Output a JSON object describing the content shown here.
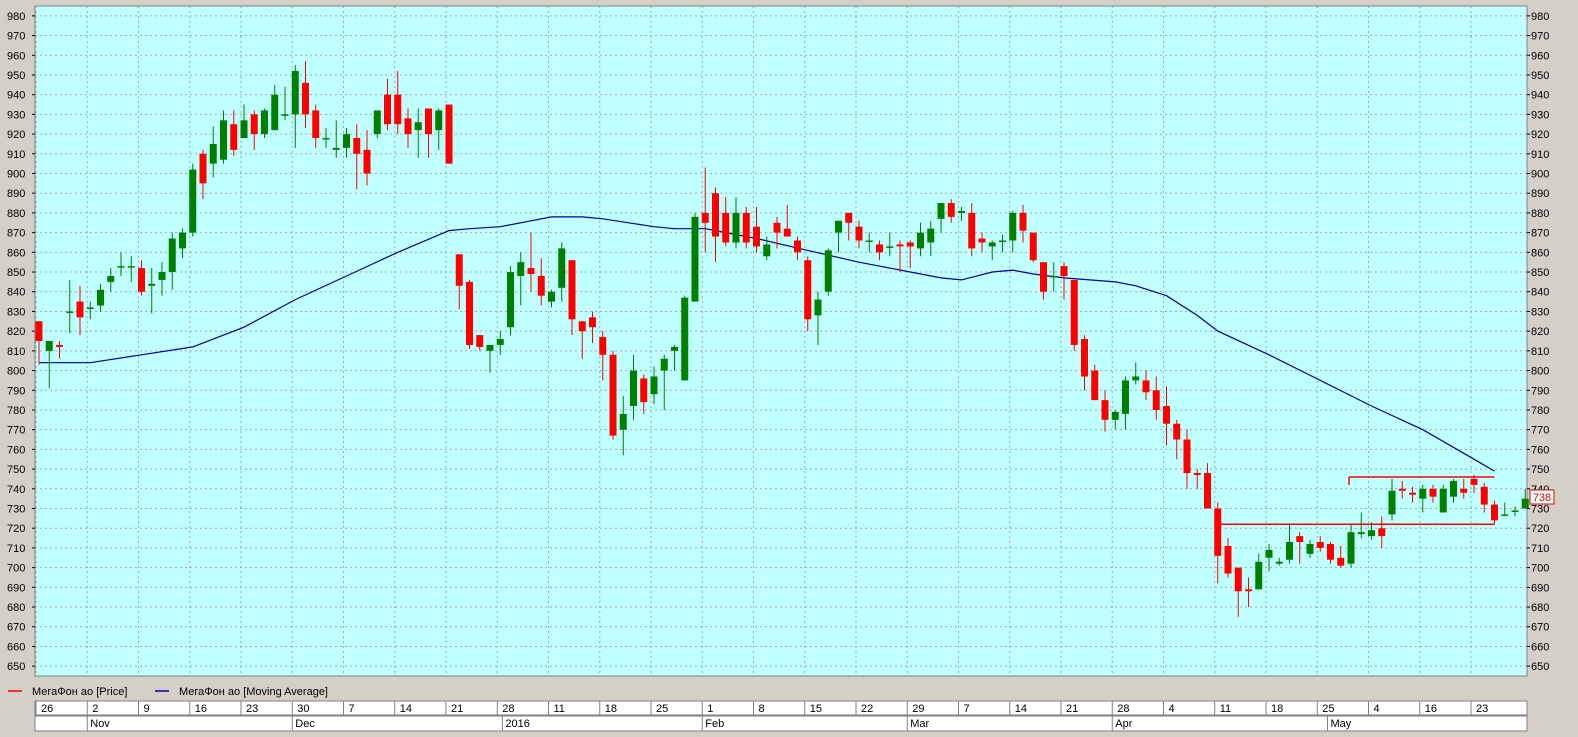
{
  "colors": {
    "background": "#c0ffff",
    "grid": "#a8a8a8",
    "up": "#008000",
    "down": "#ff0000",
    "ma": "#0000a0",
    "level": "#ff0000",
    "frame": "#d4d0c8"
  },
  "legend": [
    {
      "label": "МегаФон ао [Price]",
      "color": "#ff0000"
    },
    {
      "label": "МегаФон ао [Moving Average]",
      "color": "#0000a0"
    }
  ],
  "last_price_label": "738",
  "chart_data": {
    "type": "candlestick",
    "ylim": [
      645,
      985
    ],
    "y_ticks": [
      650,
      660,
      670,
      680,
      690,
      700,
      710,
      720,
      730,
      740,
      750,
      760,
      770,
      780,
      790,
      800,
      810,
      820,
      830,
      840,
      850,
      860,
      870,
      880,
      890,
      900,
      910,
      920,
      930,
      940,
      950,
      960,
      970,
      980
    ],
    "x_day_labels": [
      {
        "i": 0,
        "label": "26"
      },
      {
        "i": 5,
        "label": "2"
      },
      {
        "i": 10,
        "label": "9"
      },
      {
        "i": 15,
        "label": "16"
      },
      {
        "i": 20,
        "label": "23"
      },
      {
        "i": 25,
        "label": "30"
      },
      {
        "i": 30,
        "label": "7"
      },
      {
        "i": 35,
        "label": "14"
      },
      {
        "i": 40,
        "label": "21"
      },
      {
        "i": 45,
        "label": "28"
      },
      {
        "i": 50,
        "label": "11"
      },
      {
        "i": 55,
        "label": "18"
      },
      {
        "i": 60,
        "label": "25"
      },
      {
        "i": 65,
        "label": "1"
      },
      {
        "i": 70,
        "label": "8"
      },
      {
        "i": 75,
        "label": "15"
      },
      {
        "i": 80,
        "label": "22"
      },
      {
        "i": 85,
        "label": "29"
      },
      {
        "i": 90,
        "label": "7"
      },
      {
        "i": 95,
        "label": "14"
      },
      {
        "i": 100,
        "label": "21"
      },
      {
        "i": 105,
        "label": "28"
      },
      {
        "i": 110,
        "label": "4"
      },
      {
        "i": 115,
        "label": "11"
      },
      {
        "i": 120,
        "label": "18"
      },
      {
        "i": 125,
        "label": "25"
      },
      {
        "i": 130,
        "label": "4"
      },
      {
        "i": 135,
        "label": "16"
      },
      {
        "i": 140,
        "label": "23"
      }
    ],
    "x_month_labels": [
      {
        "i": 5,
        "label": "Nov"
      },
      {
        "i": 25,
        "label": "Dec"
      },
      {
        "i": 45.5,
        "label": "2016"
      },
      {
        "i": 65,
        "label": "Feb"
      },
      {
        "i": 85,
        "label": "Mar"
      },
      {
        "i": 105,
        "label": "Apr"
      },
      {
        "i": 126,
        "label": "May"
      }
    ],
    "candles": [
      {
        "o": 825,
        "h": 825,
        "l": 803,
        "c": 815
      },
      {
        "o": 810,
        "h": 815,
        "l": 791,
        "c": 815
      },
      {
        "o": 813,
        "h": 815,
        "l": 806,
        "c": 812
      },
      {
        "o": 830,
        "h": 846,
        "l": 819,
        "c": 830
      },
      {
        "o": 835,
        "h": 843,
        "l": 818,
        "c": 827
      },
      {
        "o": 832,
        "h": 835,
        "l": 826,
        "c": 832
      },
      {
        "o": 833,
        "h": 844,
        "l": 830,
        "c": 841
      },
      {
        "o": 845,
        "h": 852,
        "l": 840,
        "c": 848
      },
      {
        "o": 853,
        "h": 860,
        "l": 848,
        "c": 853
      },
      {
        "o": 853,
        "h": 858,
        "l": 845,
        "c": 853
      },
      {
        "o": 852,
        "h": 856,
        "l": 838,
        "c": 840
      },
      {
        "o": 843,
        "h": 852,
        "l": 829,
        "c": 844
      },
      {
        "o": 846,
        "h": 855,
        "l": 838,
        "c": 850
      },
      {
        "o": 850,
        "h": 870,
        "l": 841,
        "c": 867
      },
      {
        "o": 862,
        "h": 872,
        "l": 857,
        "c": 870
      },
      {
        "o": 870,
        "h": 905,
        "l": 868,
        "c": 902
      },
      {
        "o": 910,
        "h": 912,
        "l": 887,
        "c": 895
      },
      {
        "o": 905,
        "h": 924,
        "l": 898,
        "c": 915
      },
      {
        "o": 907,
        "h": 932,
        "l": 905,
        "c": 927
      },
      {
        "o": 925,
        "h": 932,
        "l": 909,
        "c": 912
      },
      {
        "o": 918,
        "h": 935,
        "l": 918,
        "c": 927
      },
      {
        "o": 930,
        "h": 932,
        "l": 912,
        "c": 920
      },
      {
        "o": 920,
        "h": 933,
        "l": 918,
        "c": 932
      },
      {
        "o": 922,
        "h": 945,
        "l": 922,
        "c": 940
      },
      {
        "o": 930,
        "h": 944,
        "l": 927,
        "c": 930
      },
      {
        "o": 930,
        "h": 955,
        "l": 913,
        "c": 952
      },
      {
        "o": 946,
        "h": 957,
        "l": 923,
        "c": 930
      },
      {
        "o": 932,
        "h": 935,
        "l": 913,
        "c": 918
      },
      {
        "o": 918,
        "h": 923,
        "l": 913,
        "c": 918
      },
      {
        "o": 912,
        "h": 927,
        "l": 908,
        "c": 913
      },
      {
        "o": 913,
        "h": 923,
        "l": 908,
        "c": 920
      },
      {
        "o": 918,
        "h": 925,
        "l": 892,
        "c": 910
      },
      {
        "o": 912,
        "h": 922,
        "l": 894,
        "c": 900
      },
      {
        "o": 920,
        "h": 932,
        "l": 918,
        "c": 932
      },
      {
        "o": 940,
        "h": 948,
        "l": 922,
        "c": 925
      },
      {
        "o": 940,
        "h": 952,
        "l": 920,
        "c": 925
      },
      {
        "o": 928,
        "h": 933,
        "l": 913,
        "c": 920
      },
      {
        "o": 922,
        "h": 933,
        "l": 908,
        "c": 926
      },
      {
        "o": 933,
        "h": 933,
        "l": 908,
        "c": 920
      },
      {
        "o": 922,
        "h": 933,
        "l": 912,
        "c": 932
      },
      {
        "o": 935,
        "h": 935,
        "l": 905,
        "c": 905
      },
      {
        "o": 859,
        "h": 859,
        "l": 831,
        "c": 843
      },
      {
        "o": 845,
        "h": 846,
        "l": 811,
        "c": 813
      },
      {
        "o": 818,
        "h": 818,
        "l": 810,
        "c": 812
      },
      {
        "o": 810,
        "h": 813,
        "l": 799,
        "c": 813
      },
      {
        "o": 813,
        "h": 820,
        "l": 808,
        "c": 816
      },
      {
        "o": 822,
        "h": 853,
        "l": 818,
        "c": 850
      },
      {
        "o": 848,
        "h": 860,
        "l": 833,
        "c": 855
      },
      {
        "o": 852,
        "h": 870,
        "l": 840,
        "c": 849
      },
      {
        "o": 848,
        "h": 857,
        "l": 833,
        "c": 838
      },
      {
        "o": 835,
        "h": 841,
        "l": 832,
        "c": 840
      },
      {
        "o": 842,
        "h": 865,
        "l": 835,
        "c": 862
      },
      {
        "o": 856,
        "h": 856,
        "l": 818,
        "c": 826
      },
      {
        "o": 825,
        "h": 825,
        "l": 806,
        "c": 820
      },
      {
        "o": 827,
        "h": 830,
        "l": 814,
        "c": 822
      },
      {
        "o": 817,
        "h": 820,
        "l": 795,
        "c": 808
      },
      {
        "o": 808,
        "h": 810,
        "l": 765,
        "c": 767
      },
      {
        "o": 770,
        "h": 787,
        "l": 757,
        "c": 778
      },
      {
        "o": 782,
        "h": 808,
        "l": 775,
        "c": 800
      },
      {
        "o": 796,
        "h": 798,
        "l": 778,
        "c": 784
      },
      {
        "o": 788,
        "h": 802,
        "l": 783,
        "c": 797
      },
      {
        "o": 800,
        "h": 808,
        "l": 780,
        "c": 806
      },
      {
        "o": 810,
        "h": 813,
        "l": 800,
        "c": 812
      },
      {
        "o": 795,
        "h": 838,
        "l": 795,
        "c": 837
      },
      {
        "o": 835,
        "h": 880,
        "l": 835,
        "c": 878
      },
      {
        "o": 880,
        "h": 903,
        "l": 860,
        "c": 875
      },
      {
        "o": 890,
        "h": 893,
        "l": 855,
        "c": 868
      },
      {
        "o": 880,
        "h": 888,
        "l": 863,
        "c": 865
      },
      {
        "o": 865,
        "h": 888,
        "l": 862,
        "c": 880
      },
      {
        "o": 880,
        "h": 883,
        "l": 862,
        "c": 865
      },
      {
        "o": 873,
        "h": 883,
        "l": 860,
        "c": 863
      },
      {
        "o": 858,
        "h": 868,
        "l": 856,
        "c": 864
      },
      {
        "o": 875,
        "h": 878,
        "l": 862,
        "c": 870
      },
      {
        "o": 872,
        "h": 884,
        "l": 868,
        "c": 868
      },
      {
        "o": 866,
        "h": 868,
        "l": 856,
        "c": 860
      },
      {
        "o": 856,
        "h": 858,
        "l": 820,
        "c": 826
      },
      {
        "o": 828,
        "h": 840,
        "l": 813,
        "c": 836
      },
      {
        "o": 840,
        "h": 862,
        "l": 838,
        "c": 861
      },
      {
        "o": 870,
        "h": 876,
        "l": 860,
        "c": 876
      },
      {
        "o": 880,
        "h": 880,
        "l": 866,
        "c": 875
      },
      {
        "o": 873,
        "h": 876,
        "l": 862,
        "c": 866
      },
      {
        "o": 866,
        "h": 870,
        "l": 860,
        "c": 866
      },
      {
        "o": 864,
        "h": 866,
        "l": 856,
        "c": 860
      },
      {
        "o": 863,
        "h": 870,
        "l": 858,
        "c": 863
      },
      {
        "o": 864,
        "h": 866,
        "l": 850,
        "c": 863
      },
      {
        "o": 865,
        "h": 866,
        "l": 852,
        "c": 863
      },
      {
        "o": 862,
        "h": 875,
        "l": 858,
        "c": 870
      },
      {
        "o": 865,
        "h": 876,
        "l": 858,
        "c": 872
      },
      {
        "o": 877,
        "h": 885,
        "l": 870,
        "c": 885
      },
      {
        "o": 885,
        "h": 887,
        "l": 875,
        "c": 878
      },
      {
        "o": 880,
        "h": 883,
        "l": 876,
        "c": 881
      },
      {
        "o": 880,
        "h": 885,
        "l": 858,
        "c": 862
      },
      {
        "o": 867,
        "h": 870,
        "l": 860,
        "c": 865
      },
      {
        "o": 863,
        "h": 866,
        "l": 856,
        "c": 865
      },
      {
        "o": 866,
        "h": 869,
        "l": 860,
        "c": 866
      },
      {
        "o": 866,
        "h": 881,
        "l": 860,
        "c": 880
      },
      {
        "o": 880,
        "h": 884,
        "l": 865,
        "c": 871
      },
      {
        "o": 870,
        "h": 870,
        "l": 855,
        "c": 856
      },
      {
        "o": 855,
        "h": 855,
        "l": 836,
        "c": 840
      },
      {
        "o": 848,
        "h": 855,
        "l": 840,
        "c": 848
      },
      {
        "o": 853,
        "h": 855,
        "l": 836,
        "c": 848
      },
      {
        "o": 846,
        "h": 846,
        "l": 810,
        "c": 813
      },
      {
        "o": 816,
        "h": 818,
        "l": 790,
        "c": 797
      },
      {
        "o": 800,
        "h": 803,
        "l": 785,
        "c": 785
      },
      {
        "o": 785,
        "h": 790,
        "l": 769,
        "c": 775
      },
      {
        "o": 775,
        "h": 780,
        "l": 770,
        "c": 779
      },
      {
        "o": 778,
        "h": 797,
        "l": 770,
        "c": 795
      },
      {
        "o": 795,
        "h": 804,
        "l": 793,
        "c": 797
      },
      {
        "o": 795,
        "h": 800,
        "l": 785,
        "c": 789
      },
      {
        "o": 790,
        "h": 797,
        "l": 775,
        "c": 780
      },
      {
        "o": 782,
        "h": 792,
        "l": 762,
        "c": 773
      },
      {
        "o": 773,
        "h": 775,
        "l": 755,
        "c": 765
      },
      {
        "o": 765,
        "h": 770,
        "l": 740,
        "c": 748
      },
      {
        "o": 748,
        "h": 750,
        "l": 740,
        "c": 747
      },
      {
        "o": 748,
        "h": 753,
        "l": 730,
        "c": 730
      },
      {
        "o": 730,
        "h": 733,
        "l": 692,
        "c": 706
      },
      {
        "o": 711,
        "h": 715,
        "l": 695,
        "c": 697
      },
      {
        "o": 700,
        "h": 700,
        "l": 675,
        "c": 688
      },
      {
        "o": 689,
        "h": 695,
        "l": 680,
        "c": 688
      },
      {
        "o": 689,
        "h": 707,
        "l": 689,
        "c": 703
      },
      {
        "o": 705,
        "h": 712,
        "l": 698,
        "c": 709
      },
      {
        "o": 702,
        "h": 705,
        "l": 701,
        "c": 703
      },
      {
        "o": 704,
        "h": 722,
        "l": 702,
        "c": 713
      },
      {
        "o": 716,
        "h": 718,
        "l": 702,
        "c": 713
      },
      {
        "o": 707,
        "h": 714,
        "l": 705,
        "c": 712
      },
      {
        "o": 713,
        "h": 716,
        "l": 708,
        "c": 710
      },
      {
        "o": 712,
        "h": 713,
        "l": 702,
        "c": 704
      },
      {
        "o": 705,
        "h": 711,
        "l": 700,
        "c": 701
      },
      {
        "o": 702,
        "h": 722,
        "l": 700,
        "c": 718
      },
      {
        "o": 717,
        "h": 728,
        "l": 715,
        "c": 718
      },
      {
        "o": 716,
        "h": 723,
        "l": 714,
        "c": 719
      },
      {
        "o": 720,
        "h": 726,
        "l": 710,
        "c": 716
      },
      {
        "o": 727,
        "h": 745,
        "l": 724,
        "c": 739
      },
      {
        "o": 740,
        "h": 744,
        "l": 735,
        "c": 739
      },
      {
        "o": 738,
        "h": 741,
        "l": 733,
        "c": 737
      },
      {
        "o": 735,
        "h": 742,
        "l": 728,
        "c": 740
      },
      {
        "o": 740,
        "h": 742,
        "l": 733,
        "c": 736
      },
      {
        "o": 728,
        "h": 742,
        "l": 728,
        "c": 740
      },
      {
        "o": 736,
        "h": 745,
        "l": 733,
        "c": 744
      },
      {
        "o": 740,
        "h": 745,
        "l": 735,
        "c": 738
      },
      {
        "o": 745,
        "h": 747,
        "l": 738,
        "c": 742
      },
      {
        "o": 741,
        "h": 743,
        "l": 728,
        "c": 732
      },
      {
        "o": 732,
        "h": 734,
        "l": 722,
        "c": 724
      },
      {
        "o": 727,
        "h": 733,
        "l": 726,
        "c": 727
      },
      {
        "o": 729,
        "h": 731,
        "l": 726,
        "c": 729
      },
      {
        "o": 730,
        "h": 740,
        "l": 730,
        "c": 735
      },
      {
        "o": 738,
        "h": 741,
        "l": 736,
        "c": 738
      }
    ],
    "moving_average": [
      [
        0,
        804
      ],
      [
        5,
        804
      ],
      [
        10,
        808
      ],
      [
        15,
        812
      ],
      [
        20,
        822
      ],
      [
        25,
        836
      ],
      [
        30,
        848
      ],
      [
        35,
        860
      ],
      [
        40,
        871
      ],
      [
        42,
        872
      ],
      [
        45,
        873
      ],
      [
        48,
        876
      ],
      [
        50,
        878
      ],
      [
        53,
        878
      ],
      [
        55,
        877
      ],
      [
        60,
        873
      ],
      [
        62,
        872
      ],
      [
        65,
        872
      ],
      [
        70,
        867
      ],
      [
        75,
        861
      ],
      [
        80,
        855
      ],
      [
        85,
        850
      ],
      [
        88,
        847
      ],
      [
        90,
        846
      ],
      [
        93,
        850
      ],
      [
        95,
        851
      ],
      [
        97,
        849
      ],
      [
        100,
        847
      ],
      [
        105,
        845
      ],
      [
        107,
        843
      ],
      [
        110,
        838
      ],
      [
        113,
        828
      ],
      [
        115,
        820
      ],
      [
        120,
        808
      ],
      [
        125,
        795
      ],
      [
        130,
        782
      ],
      [
        135,
        770
      ],
      [
        140,
        755
      ],
      [
        142,
        749
      ]
    ],
    "support_lines": [
      {
        "from": 115,
        "to": 142,
        "y": 722
      },
      {
        "from": 128,
        "to": 142,
        "y": 746
      }
    ]
  }
}
